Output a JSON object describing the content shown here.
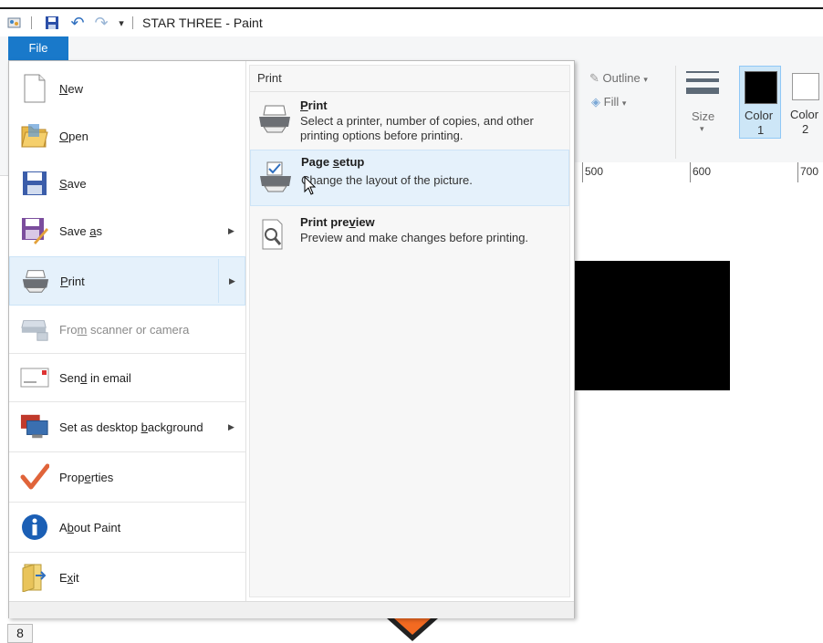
{
  "window": {
    "title": "STAR THREE - Paint"
  },
  "file_tab": {
    "label": "File"
  },
  "ribbon": {
    "outline_label": "Outline",
    "fill_label": "Fill",
    "size_label": "Size",
    "color1_label": "Color",
    "color1_num": "1",
    "color2_label": "Color",
    "color2_num": "2",
    "color1_value": "#000000",
    "color2_value": "#ffffff"
  },
  "ruler": {
    "marks": [
      "500",
      "600",
      "700"
    ]
  },
  "status": {
    "zoom_digit": "8"
  },
  "file_menu": {
    "items": [
      {
        "pre": "",
        "accel": "N",
        "post": "ew",
        "icon": "new-document-icon",
        "submenu": false
      },
      {
        "pre": "",
        "accel": "O",
        "post": "pen",
        "icon": "open-folder-icon",
        "submenu": false
      },
      {
        "pre": "",
        "accel": "S",
        "post": "ave",
        "icon": "save-disk-icon",
        "submenu": false
      },
      {
        "pre": "Save ",
        "accel": "a",
        "post": "s",
        "icon": "save-as-icon",
        "submenu": true
      },
      {
        "pre": "",
        "accel": "P",
        "post": "rint",
        "icon": "printer-icon",
        "submenu": true
      },
      {
        "pre": "Fro",
        "accel": "m",
        "post": " scanner or camera",
        "icon": "scanner-icon",
        "submenu": false
      },
      {
        "pre": "Sen",
        "accel": "d",
        "post": " in email",
        "icon": "email-icon",
        "submenu": false
      },
      {
        "pre": "Set as desktop ",
        "accel": "b",
        "post": "ackground",
        "icon": "desktop-icon",
        "submenu": true
      },
      {
        "pre": "Prop",
        "accel": "e",
        "post": "rties",
        "icon": "checkmark-icon",
        "submenu": false
      },
      {
        "pre": "A",
        "accel": "b",
        "post": "out Paint",
        "icon": "info-icon",
        "submenu": false
      },
      {
        "pre": "E",
        "accel": "x",
        "post": "it",
        "icon": "exit-icon",
        "submenu": false
      }
    ],
    "active_index": 4
  },
  "print_submenu": {
    "header": "Print",
    "items": [
      {
        "title_pre": "",
        "title_accel": "P",
        "title_post": "rint",
        "desc": "Select a printer, number of copies, and other printing options before printing.",
        "icon": "printer-icon"
      },
      {
        "title_pre": "Page ",
        "title_accel": "s",
        "title_post": "etup",
        "desc": "Change the layout of the picture.",
        "icon": "page-setup-icon"
      },
      {
        "title_pre": "Print pre",
        "title_accel": "v",
        "title_post": "iew",
        "desc": "Preview and make changes before printing.",
        "icon": "print-preview-icon"
      }
    ],
    "hover_index": 1
  }
}
